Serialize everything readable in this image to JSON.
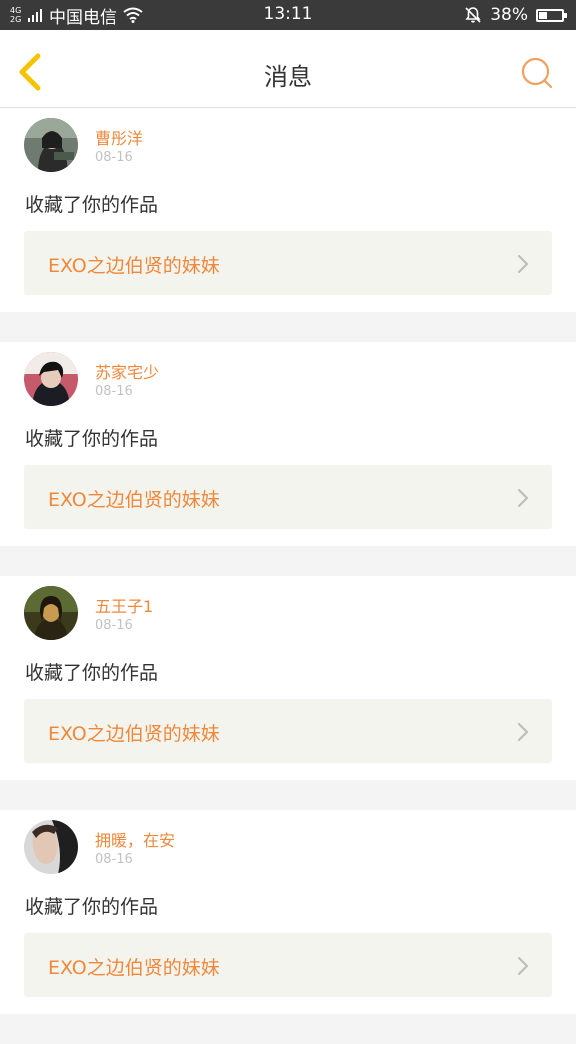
{
  "status_bar": {
    "network": "4G 2G",
    "carrier": "中国电信",
    "time": "13:11",
    "battery_percent": "38%",
    "battery_level": 0.38
  },
  "nav": {
    "title": "消息",
    "back_icon": "chevron-left-icon",
    "search_icon": "search-icon"
  },
  "colors": {
    "accent": "#f0883a",
    "back_arrow": "#f5c400",
    "card_link_bg": "#f4f4ef"
  },
  "notifications": [
    {
      "name": "曹彤洋",
      "date": "08-16",
      "action": "收藏了你的作品",
      "work_title": "EXO之边伯贤的妹妹"
    },
    {
      "name": "苏家宅少",
      "date": "08-16",
      "action": "收藏了你的作品",
      "work_title": "EXO之边伯贤的妹妹"
    },
    {
      "name": "五王子1",
      "date": "08-16",
      "action": "收藏了你的作品",
      "work_title": "EXO之边伯贤的妹妹"
    },
    {
      "name": "拥暖，在安",
      "date": "08-16",
      "action": "收藏了你的作品",
      "work_title": "EXO之边伯贤的妹妹"
    }
  ]
}
